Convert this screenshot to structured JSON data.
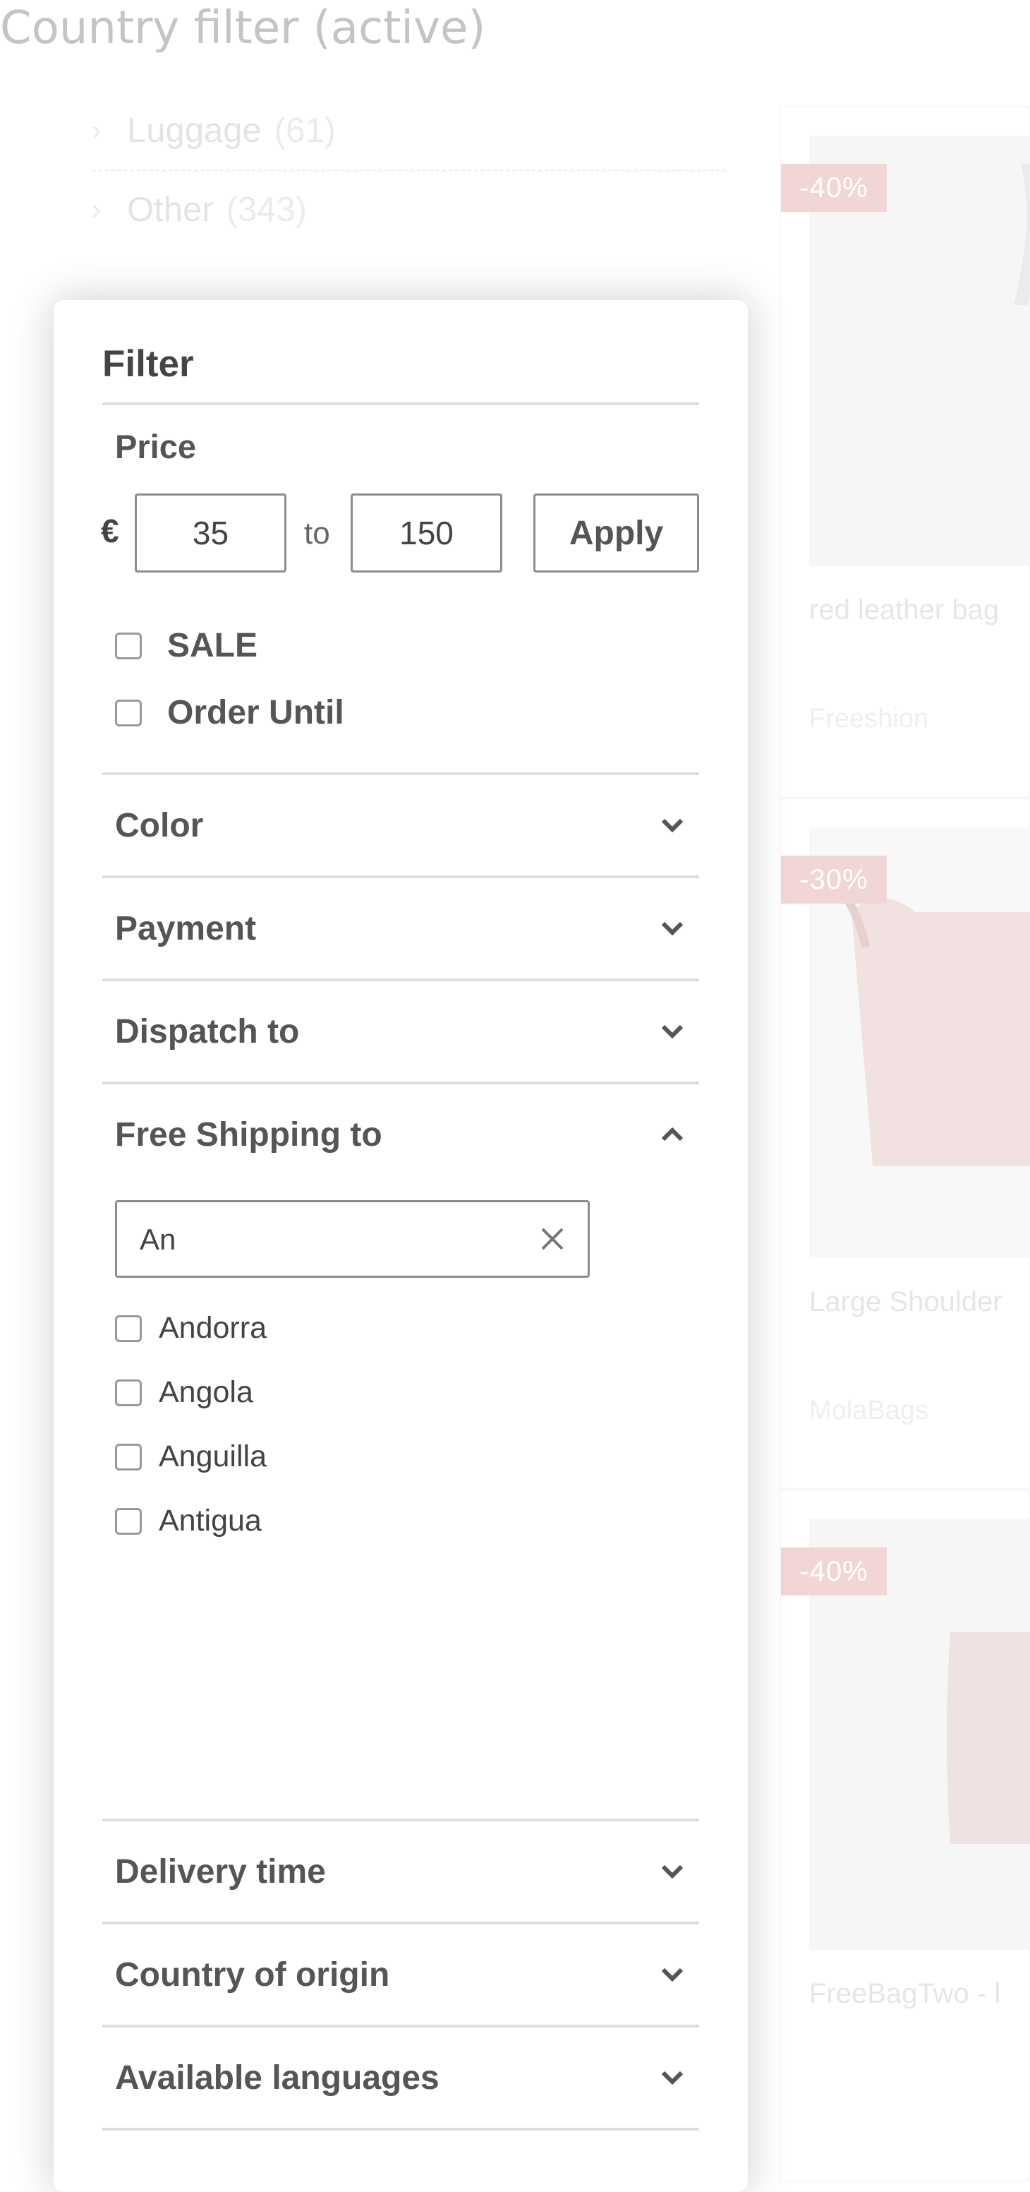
{
  "page": {
    "heading": "Country filter (active)"
  },
  "categories": [
    {
      "label": "Luggage",
      "count": "(61)"
    },
    {
      "label": "Other",
      "count": "(343)"
    }
  ],
  "products": [
    {
      "badge": "-40%",
      "title": "red leather bag",
      "shop": "Freeshion"
    },
    {
      "badge": "-30%",
      "title": "Large Shoulder",
      "shop": "MolaBags"
    },
    {
      "badge": "-40%",
      "title": "FreeBagTwo - l",
      "shop": ""
    }
  ],
  "filter": {
    "title": "Filter",
    "price": {
      "label": "Price",
      "currency": "€",
      "min": "35",
      "separator": "to",
      "max": "150",
      "apply_label": "Apply"
    },
    "checkboxes": [
      {
        "label": "SALE",
        "checked": false
      },
      {
        "label": "Order Until",
        "checked": false
      }
    ],
    "sections": [
      {
        "label": "Color",
        "expanded": false
      },
      {
        "label": "Payment",
        "expanded": false
      },
      {
        "label": "Dispatch to",
        "expanded": false
      },
      {
        "label": "Free Shipping to",
        "expanded": true
      },
      {
        "label": "Delivery time",
        "expanded": false
      },
      {
        "label": "Country of origin",
        "expanded": false
      },
      {
        "label": "Available languages",
        "expanded": false
      }
    ],
    "free_shipping": {
      "search_value": "An",
      "countries": [
        {
          "label": "Andorra",
          "checked": false
        },
        {
          "label": "Angola",
          "checked": false
        },
        {
          "label": "Anguilla",
          "checked": false
        },
        {
          "label": "Antigua",
          "checked": false
        }
      ]
    }
  },
  "icons": {
    "expand": "chevron-down-icon",
    "collapse": "chevron-up-icon",
    "clear": "close-icon",
    "category_arrow": "chevron-right-icon"
  },
  "colors": {
    "badge": "#e9b5b5",
    "text_dark": "#555555",
    "border": "#8c8c8c"
  }
}
